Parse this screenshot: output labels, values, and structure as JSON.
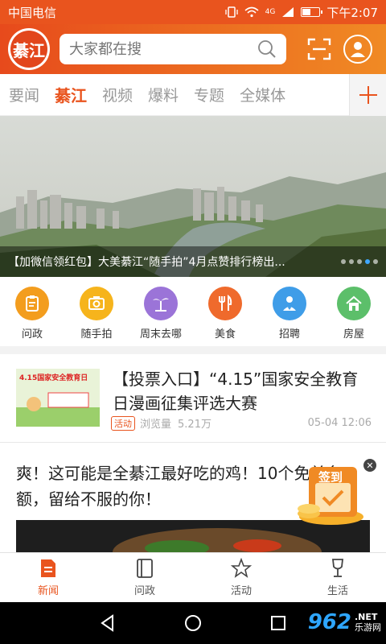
{
  "status_bar": {
    "carrier": "中国电信",
    "time": "下午2:07",
    "network": "4G"
  },
  "header": {
    "logo_text": "綦江",
    "search_placeholder": "大家都在搜"
  },
  "tabs": [
    {
      "label": "要闻",
      "active": false
    },
    {
      "label": "綦江",
      "active": true
    },
    {
      "label": "视频",
      "active": false
    },
    {
      "label": "爆料",
      "active": false
    },
    {
      "label": "专题",
      "active": false
    },
    {
      "label": "全媒体",
      "active": false
    }
  ],
  "banner": {
    "caption": "【加微信领红包】大美綦江“随手拍”4月点赞排行榜出...",
    "slide_count": 5,
    "active_slide": 4
  },
  "quick_links": [
    {
      "label": "问政",
      "icon": "clipboard-icon",
      "color": "#f39d1e"
    },
    {
      "label": "随手拍",
      "icon": "camera-icon",
      "color": "#f6b41c"
    },
    {
      "label": "周末去哪",
      "icon": "palm-tree-icon",
      "color": "#9b74d8"
    },
    {
      "label": "美食",
      "icon": "fork-knife-icon",
      "color": "#ef6a2c"
    },
    {
      "label": "招聘",
      "icon": "person-icon",
      "color": "#3f9de8"
    },
    {
      "label": "房屋",
      "icon": "house-icon",
      "color": "#5cbf6a"
    }
  ],
  "article1": {
    "title": "【投票入口】“4.15”国家安全教育日漫画征集评选大赛",
    "badge": "活动",
    "views_label": "浏览量",
    "views": "5.21万",
    "time": "05-04 12:06",
    "thumb_text": "4.15国家安全教育日"
  },
  "article2": {
    "title": "爽！这可能是全綦江最好吃的鸡！10个免单名额，留给不服的你！"
  },
  "signin": {
    "label": "签到"
  },
  "bottom_nav": [
    {
      "label": "新闻",
      "icon": "news-icon",
      "active": true
    },
    {
      "label": "问政",
      "icon": "book-icon",
      "active": false
    },
    {
      "label": "活动",
      "icon": "star-icon",
      "active": false
    },
    {
      "label": "生活",
      "icon": "wine-glass-icon",
      "active": false
    }
  ],
  "watermark": {
    "number": "962",
    "sub1": ".NET",
    "sub2": "乐游网"
  },
  "colors": {
    "brand": "#e9541e",
    "brand_light": "#f08a24",
    "text": "#222222",
    "muted": "#999999"
  }
}
